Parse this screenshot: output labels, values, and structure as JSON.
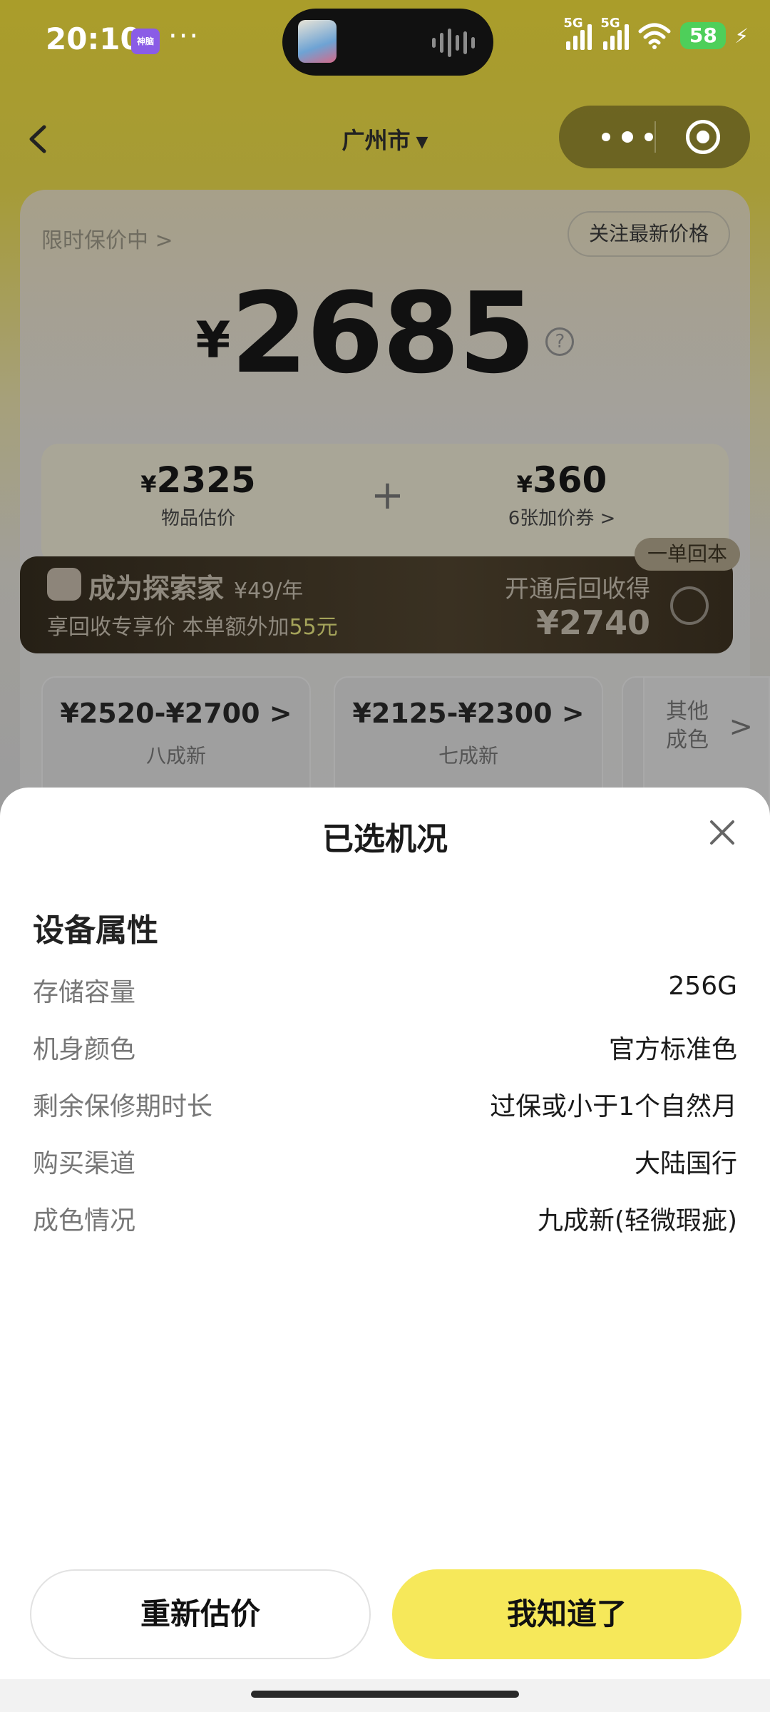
{
  "status_bar": {
    "time": "20:10",
    "app_badge": "神脑",
    "more": "···",
    "sim1": "5G",
    "sim2": "5G",
    "battery": "58"
  },
  "nav": {
    "city": "广州市",
    "city_caret": "▼"
  },
  "price_card": {
    "protect_link": "限时保价中 >",
    "follow_button": "关注最新价格",
    "currency": "¥",
    "price": "2685",
    "help": "?"
  },
  "breakdown": {
    "item_value": "2325",
    "item_label": "物品估价",
    "plus": "+",
    "coupon_value": "360",
    "coupon_label": "6张加价券 >"
  },
  "member_banner": {
    "title": "成为探索家",
    "fee": "¥49/年",
    "subtitle_prefix": "享回收专享价 本单额外加",
    "subtitle_bonus": "55元",
    "right_title": "开通后回收得",
    "right_value": "¥2740",
    "tag": "一单回本"
  },
  "grades": [
    {
      "price": "¥2520-¥2700 >",
      "label": "八成新"
    },
    {
      "price": "¥2125-¥2300 >",
      "label": "七成新"
    }
  ],
  "grade_other": {
    "line1": "其他",
    "line2": "成色",
    "chevron": ">"
  },
  "sheet": {
    "title": "已选机况",
    "section_title": "设备属性",
    "attributes": [
      {
        "key": "存储容量",
        "value": "256G"
      },
      {
        "key": "机身颜色",
        "value": "官方标准色"
      },
      {
        "key": "剩余保修期时长",
        "value": "过保或小于1个自然月"
      },
      {
        "key": "购买渠道",
        "value": "大陆国行"
      },
      {
        "key": "成色情况",
        "value": "九成新(轻微瑕疵)"
      }
    ],
    "reestimate_button": "重新估价",
    "gotit_button": "我知道了"
  },
  "colors": {
    "accent_yellow": "#f6e85a",
    "header_olive": "#aa9d2a",
    "battery_green": "#4ecf5a"
  },
  "icons": [
    "back-icon",
    "more-dots-icon",
    "close-target-icon",
    "help-icon",
    "close-icon",
    "chevron-right-icon",
    "caret-down-icon"
  ]
}
